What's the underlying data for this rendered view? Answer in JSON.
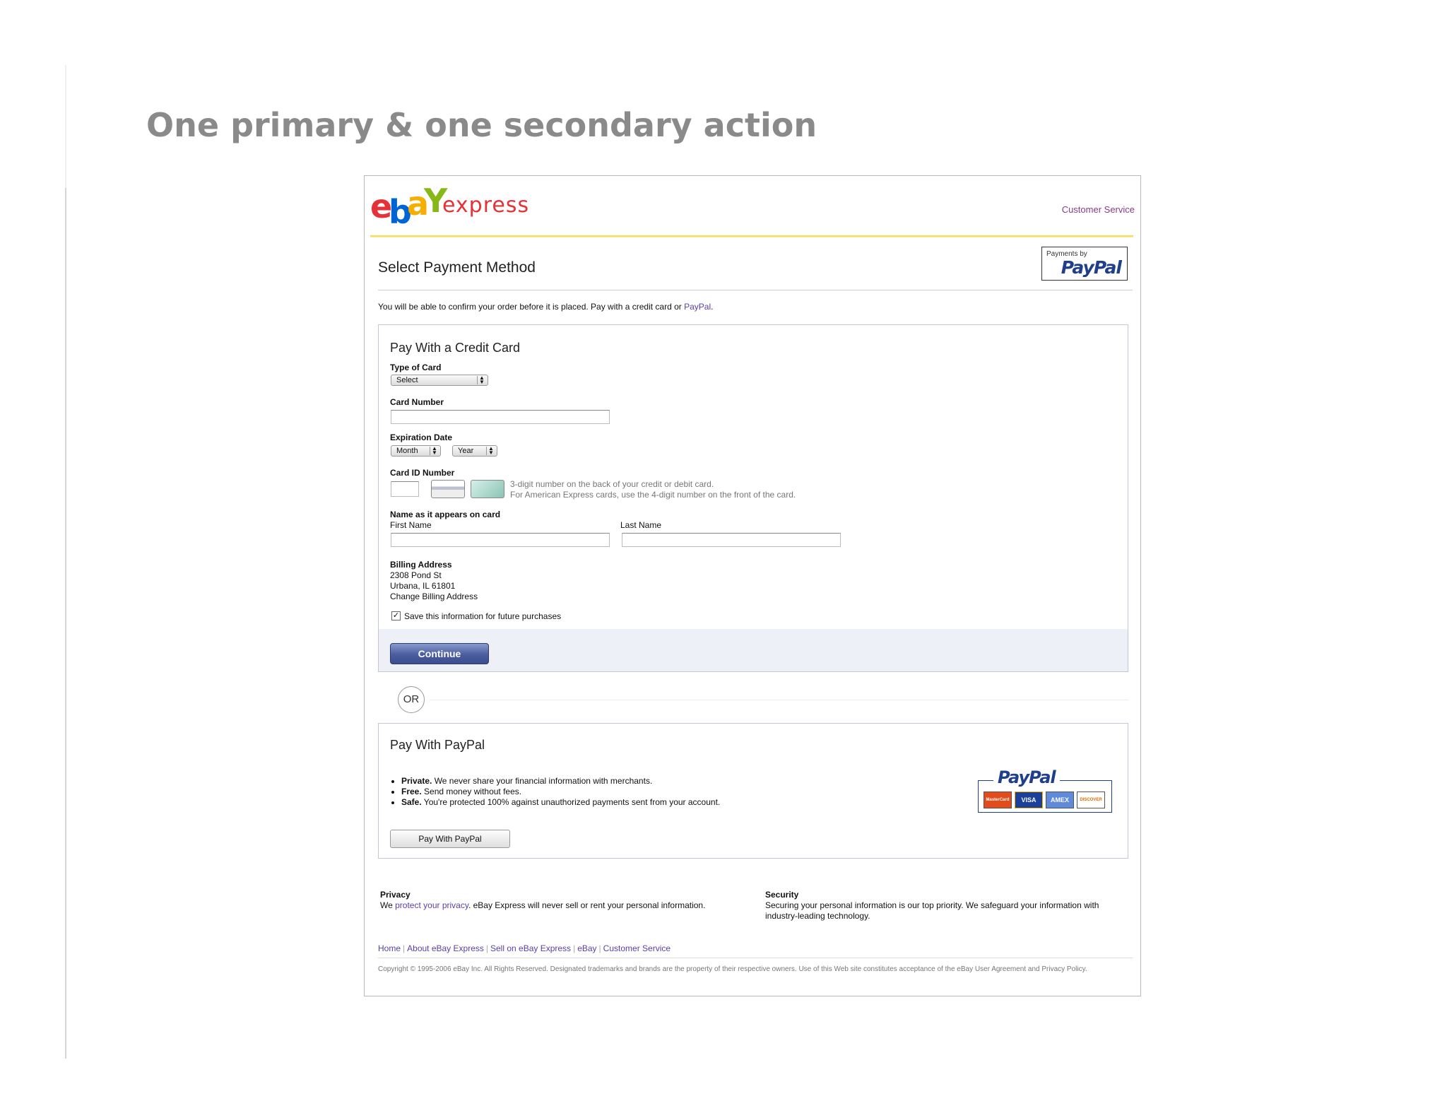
{
  "slide": {
    "title": "One primary & one secondary action"
  },
  "header": {
    "logo_letters": [
      "e",
      "b",
      "a",
      "Y"
    ],
    "logo_express": "express",
    "customer_service": "Customer Service",
    "paypal_badge_small": "Payments by",
    "paypal_badge_word": "PayPal"
  },
  "page": {
    "heading": "Select Payment Method",
    "intro_text": "You will be able to confirm your order before it is placed. Pay with a credit card or ",
    "intro_link": "PayPal",
    "intro_end": "."
  },
  "credit_card": {
    "title": "Pay With a Credit Card",
    "type_label": "Type of Card",
    "type_select": "Select",
    "number_label": "Card Number",
    "number_value": "",
    "exp_label": "Expiration Date",
    "month_select": "Month",
    "year_select": "Year",
    "cid_label": "Card ID Number",
    "cid_hint_1": "3-digit number on the back of your credit or debit card.",
    "cid_hint_2": "For American Express cards, use the 4-digit number on the front of the card.",
    "name_label": "Name as it appears on card",
    "first_name_label": "First Name",
    "last_name_label": "Last Name",
    "billing_label": "Billing Address",
    "billing_line1": "2308 Pond St",
    "billing_line2": "Urbana, IL 61801",
    "change_billing": "Change Billing Address",
    "save_info": "Save this information for future purchases",
    "save_checked": true,
    "continue": "Continue"
  },
  "or_label": "OR",
  "paypal": {
    "title": "Pay With PayPal",
    "bullets": [
      {
        "bold": "Private.",
        "text": " We never share your financial information with merchants."
      },
      {
        "bold": "Free.",
        "text": " Send money without fees."
      },
      {
        "bold": "Safe.",
        "text": " You're protected 100% against unauthorized payments sent from your account."
      }
    ],
    "button": "Pay With PayPal",
    "logo_word": "PayPal",
    "cards": [
      "MasterCard",
      "VISA",
      "AMEX",
      "DISCOVER"
    ]
  },
  "footer": {
    "privacy_heading": "Privacy",
    "privacy_pre": "We ",
    "privacy_link": "protect your privacy",
    "privacy_post": ". eBay Express will never sell or rent your personal information.",
    "security_heading": "Security",
    "security_text": "Securing your personal information is our top priority. We safeguard your information with industry-leading technology.",
    "links": [
      "Home",
      "About eBay Express",
      "Sell on eBay Express",
      "eBay",
      "Customer Service"
    ],
    "copyright": "Copyright © 1995-2006 eBay Inc. All Rights Reserved. Designated trademarks and brands are the property of their respective owners. Use of this Web site constitutes acceptance of the eBay User Agreement and Privacy Policy."
  },
  "colors": {
    "link": "#5a3fa8",
    "primary_button": "#4a5d9e",
    "title_gray": "#8a8a8a"
  }
}
